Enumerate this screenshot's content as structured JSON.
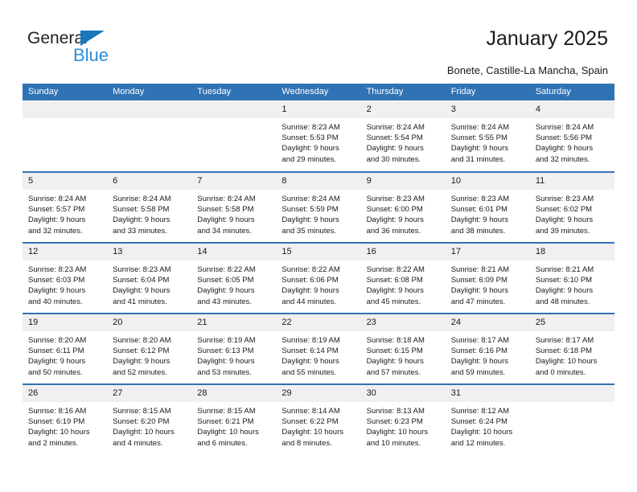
{
  "brand": {
    "logo_text_1": "General",
    "logo_text_2": "Blue",
    "triangle_icon": "triangle-icon",
    "colors": {
      "dark": "#231f20",
      "blue": "#2c8fd6",
      "triangle": "#1b75bb"
    }
  },
  "header": {
    "title": "January 2025",
    "subtitle": "Bonete, Castille-La Mancha, Spain"
  },
  "calendar": {
    "accent_color": "#3073b5",
    "daynum_strip_color": "#f0f0f0",
    "weekdays": [
      "Sunday",
      "Monday",
      "Tuesday",
      "Wednesday",
      "Thursday",
      "Friday",
      "Saturday"
    ],
    "weeks": [
      [
        {
          "day": "",
          "empty": true,
          "lines": []
        },
        {
          "day": "",
          "empty": true,
          "lines": []
        },
        {
          "day": "",
          "empty": true,
          "lines": []
        },
        {
          "day": "1",
          "empty": false,
          "lines": [
            "Sunrise: 8:23 AM",
            "Sunset: 5:53 PM",
            "Daylight: 9 hours",
            "and 29 minutes."
          ]
        },
        {
          "day": "2",
          "empty": false,
          "lines": [
            "Sunrise: 8:24 AM",
            "Sunset: 5:54 PM",
            "Daylight: 9 hours",
            "and 30 minutes."
          ]
        },
        {
          "day": "3",
          "empty": false,
          "lines": [
            "Sunrise: 8:24 AM",
            "Sunset: 5:55 PM",
            "Daylight: 9 hours",
            "and 31 minutes."
          ]
        },
        {
          "day": "4",
          "empty": false,
          "lines": [
            "Sunrise: 8:24 AM",
            "Sunset: 5:56 PM",
            "Daylight: 9 hours",
            "and 32 minutes."
          ]
        }
      ],
      [
        {
          "day": "5",
          "empty": false,
          "lines": [
            "Sunrise: 8:24 AM",
            "Sunset: 5:57 PM",
            "Daylight: 9 hours",
            "and 32 minutes."
          ]
        },
        {
          "day": "6",
          "empty": false,
          "lines": [
            "Sunrise: 8:24 AM",
            "Sunset: 5:58 PM",
            "Daylight: 9 hours",
            "and 33 minutes."
          ]
        },
        {
          "day": "7",
          "empty": false,
          "lines": [
            "Sunrise: 8:24 AM",
            "Sunset: 5:58 PM",
            "Daylight: 9 hours",
            "and 34 minutes."
          ]
        },
        {
          "day": "8",
          "empty": false,
          "lines": [
            "Sunrise: 8:24 AM",
            "Sunset: 5:59 PM",
            "Daylight: 9 hours",
            "and 35 minutes."
          ]
        },
        {
          "day": "9",
          "empty": false,
          "lines": [
            "Sunrise: 8:23 AM",
            "Sunset: 6:00 PM",
            "Daylight: 9 hours",
            "and 36 minutes."
          ]
        },
        {
          "day": "10",
          "empty": false,
          "lines": [
            "Sunrise: 8:23 AM",
            "Sunset: 6:01 PM",
            "Daylight: 9 hours",
            "and 38 minutes."
          ]
        },
        {
          "day": "11",
          "empty": false,
          "lines": [
            "Sunrise: 8:23 AM",
            "Sunset: 6:02 PM",
            "Daylight: 9 hours",
            "and 39 minutes."
          ]
        }
      ],
      [
        {
          "day": "12",
          "empty": false,
          "lines": [
            "Sunrise: 8:23 AM",
            "Sunset: 6:03 PM",
            "Daylight: 9 hours",
            "and 40 minutes."
          ]
        },
        {
          "day": "13",
          "empty": false,
          "lines": [
            "Sunrise: 8:23 AM",
            "Sunset: 6:04 PM",
            "Daylight: 9 hours",
            "and 41 minutes."
          ]
        },
        {
          "day": "14",
          "empty": false,
          "lines": [
            "Sunrise: 8:22 AM",
            "Sunset: 6:05 PM",
            "Daylight: 9 hours",
            "and 43 minutes."
          ]
        },
        {
          "day": "15",
          "empty": false,
          "lines": [
            "Sunrise: 8:22 AM",
            "Sunset: 6:06 PM",
            "Daylight: 9 hours",
            "and 44 minutes."
          ]
        },
        {
          "day": "16",
          "empty": false,
          "lines": [
            "Sunrise: 8:22 AM",
            "Sunset: 6:08 PM",
            "Daylight: 9 hours",
            "and 45 minutes."
          ]
        },
        {
          "day": "17",
          "empty": false,
          "lines": [
            "Sunrise: 8:21 AM",
            "Sunset: 6:09 PM",
            "Daylight: 9 hours",
            "and 47 minutes."
          ]
        },
        {
          "day": "18",
          "empty": false,
          "lines": [
            "Sunrise: 8:21 AM",
            "Sunset: 6:10 PM",
            "Daylight: 9 hours",
            "and 48 minutes."
          ]
        }
      ],
      [
        {
          "day": "19",
          "empty": false,
          "lines": [
            "Sunrise: 8:20 AM",
            "Sunset: 6:11 PM",
            "Daylight: 9 hours",
            "and 50 minutes."
          ]
        },
        {
          "day": "20",
          "empty": false,
          "lines": [
            "Sunrise: 8:20 AM",
            "Sunset: 6:12 PM",
            "Daylight: 9 hours",
            "and 52 minutes."
          ]
        },
        {
          "day": "21",
          "empty": false,
          "lines": [
            "Sunrise: 8:19 AM",
            "Sunset: 6:13 PM",
            "Daylight: 9 hours",
            "and 53 minutes."
          ]
        },
        {
          "day": "22",
          "empty": false,
          "lines": [
            "Sunrise: 8:19 AM",
            "Sunset: 6:14 PM",
            "Daylight: 9 hours",
            "and 55 minutes."
          ]
        },
        {
          "day": "23",
          "empty": false,
          "lines": [
            "Sunrise: 8:18 AM",
            "Sunset: 6:15 PM",
            "Daylight: 9 hours",
            "and 57 minutes."
          ]
        },
        {
          "day": "24",
          "empty": false,
          "lines": [
            "Sunrise: 8:17 AM",
            "Sunset: 6:16 PM",
            "Daylight: 9 hours",
            "and 59 minutes."
          ]
        },
        {
          "day": "25",
          "empty": false,
          "lines": [
            "Sunrise: 8:17 AM",
            "Sunset: 6:18 PM",
            "Daylight: 10 hours",
            "and 0 minutes."
          ]
        }
      ],
      [
        {
          "day": "26",
          "empty": false,
          "lines": [
            "Sunrise: 8:16 AM",
            "Sunset: 6:19 PM",
            "Daylight: 10 hours",
            "and 2 minutes."
          ]
        },
        {
          "day": "27",
          "empty": false,
          "lines": [
            "Sunrise: 8:15 AM",
            "Sunset: 6:20 PM",
            "Daylight: 10 hours",
            "and 4 minutes."
          ]
        },
        {
          "day": "28",
          "empty": false,
          "lines": [
            "Sunrise: 8:15 AM",
            "Sunset: 6:21 PM",
            "Daylight: 10 hours",
            "and 6 minutes."
          ]
        },
        {
          "day": "29",
          "empty": false,
          "lines": [
            "Sunrise: 8:14 AM",
            "Sunset: 6:22 PM",
            "Daylight: 10 hours",
            "and 8 minutes."
          ]
        },
        {
          "day": "30",
          "empty": false,
          "lines": [
            "Sunrise: 8:13 AM",
            "Sunset: 6:23 PM",
            "Daylight: 10 hours",
            "and 10 minutes."
          ]
        },
        {
          "day": "31",
          "empty": false,
          "lines": [
            "Sunrise: 8:12 AM",
            "Sunset: 6:24 PM",
            "Daylight: 10 hours",
            "and 12 minutes."
          ]
        },
        {
          "day": "",
          "empty": true,
          "lines": []
        }
      ]
    ]
  }
}
